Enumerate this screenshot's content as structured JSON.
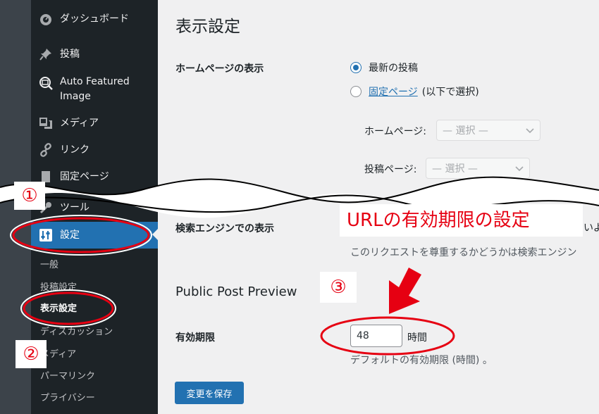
{
  "sidebar": {
    "items": [
      {
        "label": "ダッシュボード",
        "icon": "dashboard-icon"
      },
      {
        "label": "投稿",
        "icon": "pin-icon"
      },
      {
        "label_line1": "Auto Featured",
        "label_line2": "Image",
        "icon": "image-search-icon"
      },
      {
        "label": "メディア",
        "icon": "media-icon"
      },
      {
        "label": "リンク",
        "icon": "link-icon"
      },
      {
        "label": "固定ページ",
        "icon": "page-icon"
      },
      {
        "label": "ツール",
        "icon": "tools-icon"
      },
      {
        "label": "設定",
        "icon": "settings-icon"
      }
    ],
    "submenu": [
      "一般",
      "投稿設定",
      "表示設定",
      "ディスカッション",
      "メディア",
      "パーマリンク",
      "プライバシー"
    ]
  },
  "main": {
    "title": "表示設定",
    "homepage": {
      "label": "ホームページの表示",
      "option_latest": "最新の投稿",
      "option_static_link": "固定ページ",
      "option_static_suffix": "(以下で選択)",
      "homepage_select_label": "ホームページ:",
      "posts_select_label": "投稿ページ:",
      "select_placeholder": "— 選択 —"
    },
    "search": {
      "label": "検索エンジンでの表示",
      "checkbox_tail": "いよ",
      "description": "このリクエストを尊重するかどうかは検索エンジン"
    },
    "preview": {
      "heading": "Public Post Preview",
      "expiry_label": "有効期限",
      "expiry_value": "48",
      "expiry_unit": "時間",
      "expiry_description": "デフォルトの有効期限 (時間) 。"
    },
    "save_label": "変更を保存"
  },
  "annotations": {
    "marker1": "①",
    "marker2": "②",
    "marker3": "③",
    "callout": "URLの有効期限の設定",
    "color": "#e60012"
  }
}
